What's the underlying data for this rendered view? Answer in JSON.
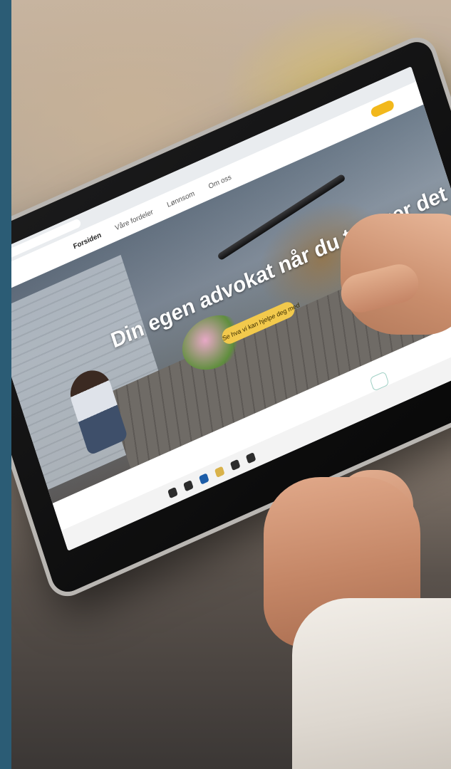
{
  "photo": {
    "subject": "Hands holding a tablet showing a law firm website",
    "side_bar_color": "#2b5c75"
  },
  "tablet_screen": {
    "nav": {
      "items": [
        "Forsiden",
        "Våre fordeler",
        "Lønnsom",
        "Om oss"
      ],
      "cta_color": "#f2b81c"
    },
    "hero": {
      "title": "Din egen advokat når du trenger det",
      "cta_label": "Se hva vi kan hjelpe deg med",
      "cta_color": "#f2c94c"
    },
    "taskbar_icons": [
      "start-icon",
      "search-icon",
      "edge-icon",
      "store-icon",
      "mail-icon",
      "explorer-icon"
    ]
  },
  "colors": {
    "skin": "#d9a07f",
    "sleeve": "#ece7e0",
    "tablet_bezel": "#101010",
    "tablet_frame": "#b9b6b2"
  }
}
